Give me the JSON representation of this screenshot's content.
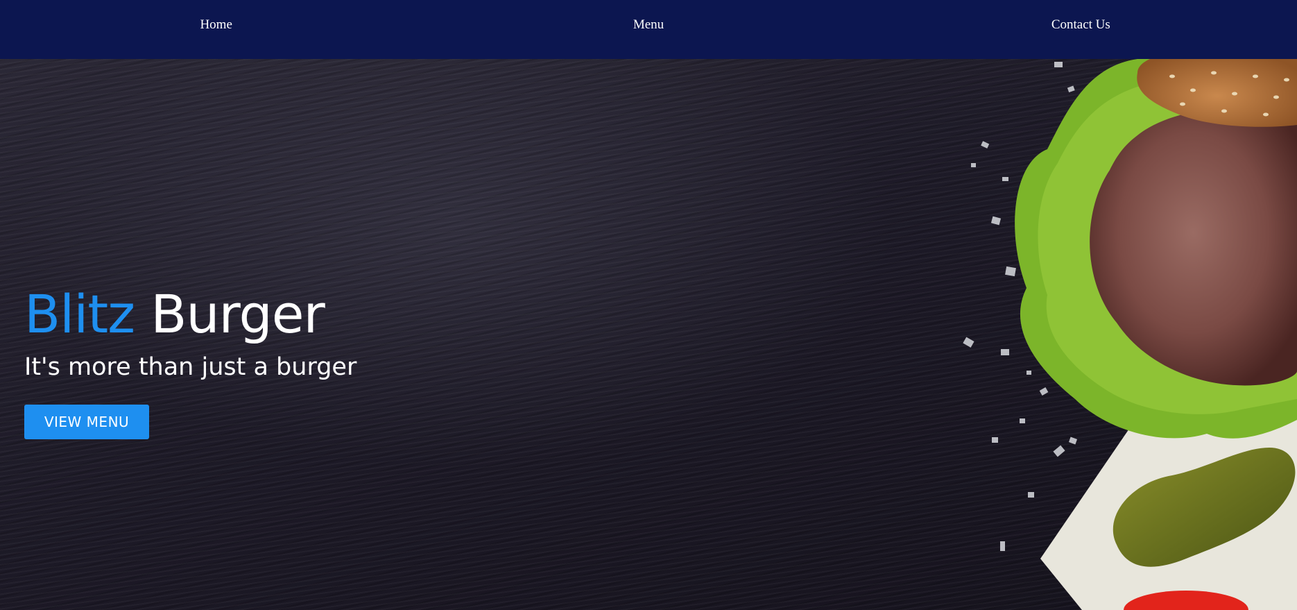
{
  "nav": {
    "items": [
      {
        "label": "Home"
      },
      {
        "label": "Menu"
      },
      {
        "label": "Contact Us"
      }
    ],
    "background_color": "#0c1650"
  },
  "hero": {
    "title_accent": "Blitz",
    "title_rest": "Burger",
    "tagline": "It's more than just a burger",
    "cta_label": "VIEW MENU",
    "accent_color": "#1e8ff0",
    "image_subject": "burger-ingredients-on-slate"
  }
}
